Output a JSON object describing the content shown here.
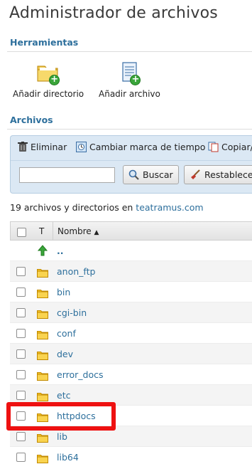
{
  "page": {
    "title": "Administrador de archivos"
  },
  "tools_section": {
    "title": "Herramientas",
    "items": [
      {
        "label": "Añadir directorio",
        "icon": "add-folder-icon"
      },
      {
        "label": "Añadir archivo",
        "icon": "add-file-icon"
      }
    ]
  },
  "files_section": {
    "title": "Archivos"
  },
  "toolbar": {
    "delete_label": "Eliminar",
    "timestamp_label": "Cambiar marca de tiempo",
    "copy_label": "Copiar/",
    "search_value": "",
    "search_button": "Buscar",
    "reset_button": "Restablecer"
  },
  "summary": {
    "text": "19 archivos y directorios en ",
    "domain": "teatramus.com"
  },
  "table": {
    "col_type": "T",
    "col_name": "Nombre",
    "sort_indicator": "▲",
    "rows": [
      {
        "name": "..",
        "type": "parent",
        "icon": "parent-directory-icon"
      },
      {
        "name": "anon_ftp",
        "type": "folder",
        "icon": "folder-icon"
      },
      {
        "name": "bin",
        "type": "folder",
        "icon": "folder-icon"
      },
      {
        "name": "cgi-bin",
        "type": "folder",
        "icon": "folder-icon"
      },
      {
        "name": "conf",
        "type": "folder",
        "icon": "folder-icon"
      },
      {
        "name": "dev",
        "type": "folder",
        "icon": "folder-icon"
      },
      {
        "name": "error_docs",
        "type": "folder",
        "icon": "folder-icon"
      },
      {
        "name": "etc",
        "type": "folder",
        "icon": "folder-icon"
      },
      {
        "name": "httpdocs",
        "type": "folder",
        "icon": "folder-icon",
        "highlighted": true
      },
      {
        "name": "lib",
        "type": "folder",
        "icon": "folder-icon"
      },
      {
        "name": "lib64",
        "type": "folder",
        "icon": "folder-icon"
      }
    ]
  },
  "colors": {
    "accent": "#2d6f9c",
    "highlight": "#ee1111",
    "toolbar_bg": "#dbe8f4"
  }
}
